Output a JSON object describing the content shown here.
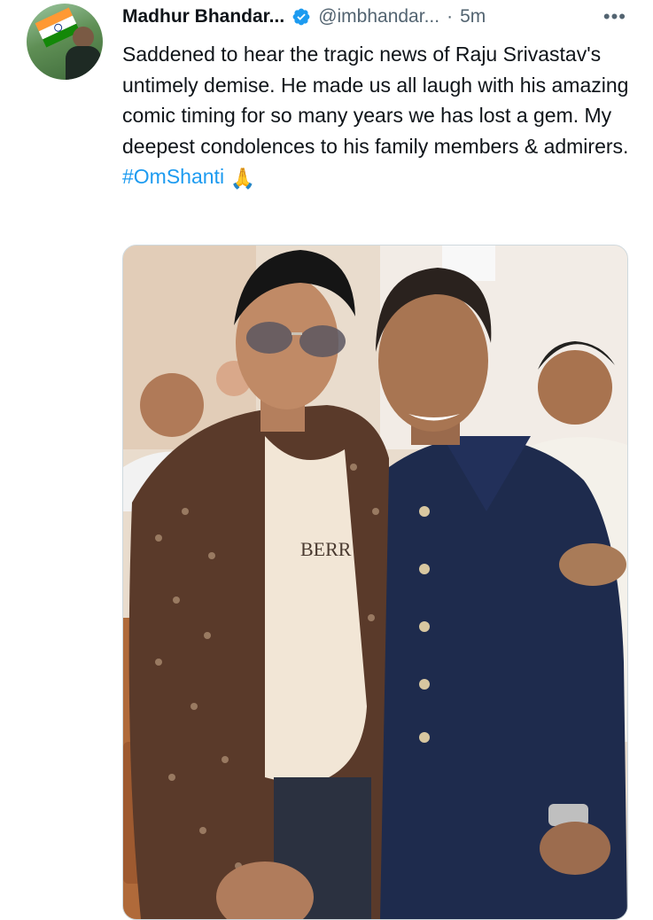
{
  "tweet": {
    "author_name": "Madhur Bhandar...",
    "handle": "@imbhandar...",
    "separator": "·",
    "time": "5m",
    "more_label": "•••",
    "text": "Saddened to hear the tragic news of Raju Srivastav's untimely demise. He made us all laugh with his amazing comic timing for so many years we has lost a gem. My deepest condolences to his family members & admirers.",
    "hashtag": "#OmShanti",
    "emoji": "🙏"
  },
  "icons": {
    "verified": "verified-badge-icon",
    "more": "more-options-icon",
    "pray": "folded-hands-icon"
  },
  "colors": {
    "link": "#1d9bf0",
    "secondary_text": "#536471",
    "verified": "#1d9bf0"
  }
}
